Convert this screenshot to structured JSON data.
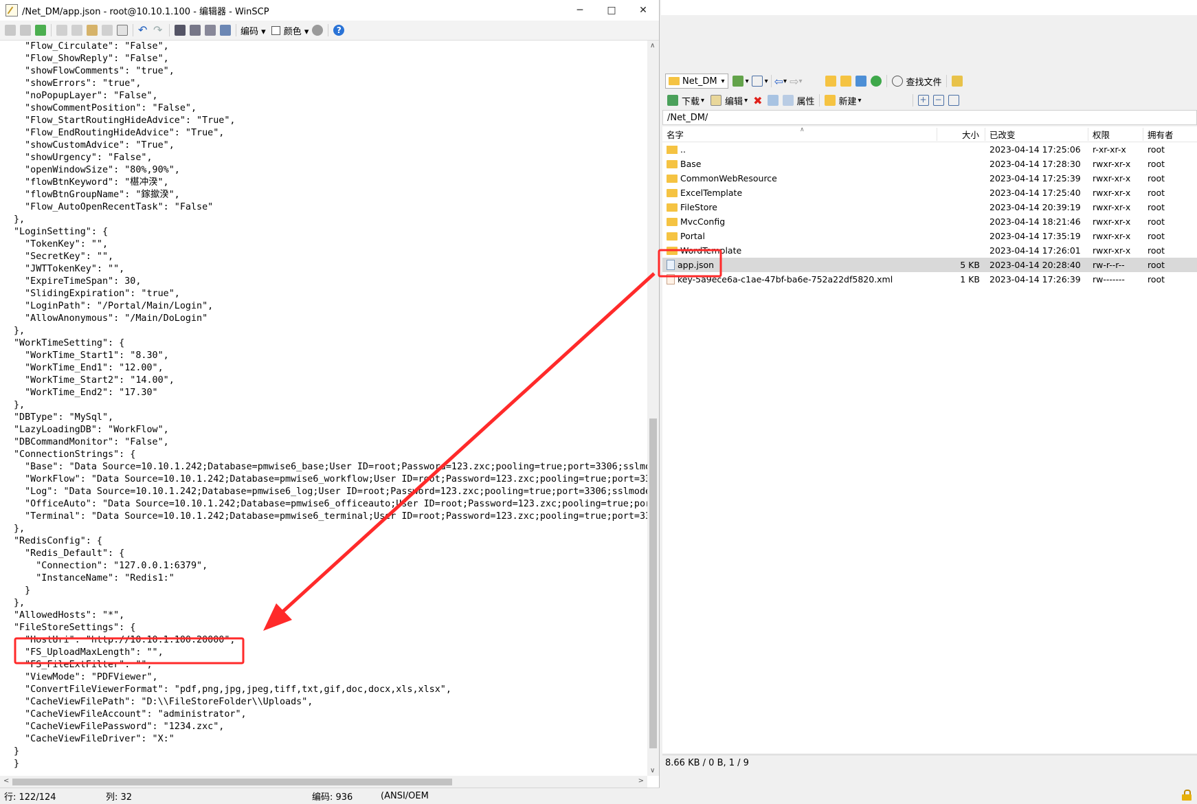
{
  "editor": {
    "title": "/Net_DM/app.json - root@10.10.1.100 - 编辑器 - WinSCP",
    "toolbar": {
      "encoding_label": "编码",
      "color_label": "颜色"
    },
    "code_lines": [
      "  \"Flow_Circulate\": \"False\",",
      "  \"Flow_ShowReply\": \"False\",",
      "  \"showFlowComments\": \"true\",",
      "  \"showErrors\": \"true\",",
      "  \"noPopupLayer\": \"False\",",
      "  \"showCommentPosition\": \"False\",",
      "  \"Flow_StartRoutingHideAdvice\": \"True\",",
      "  \"Flow_EndRoutingHideAdvice\": \"True\",",
      "  \"showCustomAdvice\": \"True\",",
      "  \"showUrgency\": \"False\",",
      "  \"openWindowSize\": \"80%,90%\",",
      "  \"flowBtnKeyword\": \"椹冲湀\",",
      "  \"flowBtnGroupName\": \"鎵撳湀\",",
      "  \"Flow_AutoOpenRecentTask\": \"False\"",
      "},",
      "\"LoginSetting\": {",
      "  \"TokenKey\": \"\",",
      "  \"SecretKey\": \"\",",
      "  \"JWTTokenKey\": \"\",",
      "  \"ExpireTimeSpan\": 30,",
      "  \"SlidingExpiration\": \"true\",",
      "  \"LoginPath\": \"/Portal/Main/Login\",",
      "  \"AllowAnonymous\": \"/Main/DoLogin\"",
      "},",
      "\"WorkTimeSetting\": {",
      "  \"WorkTime_Start1\": \"8.30\",",
      "  \"WorkTime_End1\": \"12.00\",",
      "  \"WorkTime_Start2\": \"14.00\",",
      "  \"WorkTime_End2\": \"17.30\"",
      "},",
      "\"DBType\": \"MySql\",",
      "\"LazyLoadingDB\": \"WorkFlow\",",
      "\"DBCommandMonitor\": \"False\",",
      "\"ConnectionStrings\": {",
      "  \"Base\": \"Data Source=10.10.1.242;Database=pmwise6_base;User ID=root;Password=123.zxc;pooling=true;port=3306;sslmo",
      "  \"WorkFlow\": \"Data Source=10.10.1.242;Database=pmwise6_workflow;User ID=root;Password=123.zxc;pooling=true;port=33",
      "  \"Log\": \"Data Source=10.10.1.242;Database=pmwise6_log;User ID=root;Password=123.zxc;pooling=true;port=3306;sslmode",
      "  \"OfficeAuto\": \"Data Source=10.10.1.242;Database=pmwise6_officeauto;User ID=root;Password=123.zxc;pooling=true;por",
      "  \"Terminal\": \"Data Source=10.10.1.242;Database=pmwise6_terminal;User ID=root;Password=123.zxc;pooling=true;port=33",
      "},",
      "\"RedisConfig\": {",
      "  \"Redis_Default\": {",
      "    \"Connection\": \"127.0.0.1:6379\",",
      "    \"InstanceName\": \"Redis1:\"",
      "  }",
      "},",
      "\"AllowedHosts\": \"*\",",
      "\"FileStoreSettings\": {",
      "  \"HostUri\": \"http://10.10.1.100:20000\",",
      "  \"FS_UploadMaxLength\": \"\",",
      "  \"FS_FileExtFilter\": \"\",",
      "  \"ViewMode\": \"PDFViewer\",",
      "  \"ConvertFileViewerFormat\": \"pdf,png,jpg,jpeg,tiff,txt,gif,doc,docx,xls,xlsx\",",
      "  \"CacheViewFilePath\": \"D:\\\\FileStoreFolder\\\\Uploads\",",
      "  \"CacheViewFileAccount\": \"administrator\",",
      "  \"CacheViewFilePassword\": \"1234.zxc\",",
      "  \"CacheViewFileDriver\": \"X:\"",
      "}",
      "}"
    ],
    "status": {
      "line": "行: 122/124",
      "col": "列: 32",
      "encoding": "编码: 936",
      "charset": "(ANSI/OEM"
    }
  },
  "explorer": {
    "toolbar": {
      "location": "Net_DM",
      "find_files": "查找文件",
      "download": "下载",
      "edit": "编辑",
      "properties": "属性",
      "new": "新建"
    },
    "path": "/Net_DM/",
    "columns": {
      "name": "名字",
      "size": "大小",
      "changed": "已改变",
      "rights": "权限",
      "owner": "拥有者"
    },
    "files": [
      {
        "name": "..",
        "size": "",
        "changed": "2023-04-14 17:25:06",
        "rights": "r-xr-xr-x",
        "owner": "root",
        "kind": "up"
      },
      {
        "name": "Base",
        "size": "",
        "changed": "2023-04-14 17:28:30",
        "rights": "rwxr-xr-x",
        "owner": "root",
        "kind": "folder"
      },
      {
        "name": "CommonWebResource",
        "size": "",
        "changed": "2023-04-14 17:25:39",
        "rights": "rwxr-xr-x",
        "owner": "root",
        "kind": "folder"
      },
      {
        "name": "ExcelTemplate",
        "size": "",
        "changed": "2023-04-14 17:25:40",
        "rights": "rwxr-xr-x",
        "owner": "root",
        "kind": "folder"
      },
      {
        "name": "FileStore",
        "size": "",
        "changed": "2023-04-14 20:39:19",
        "rights": "rwxr-xr-x",
        "owner": "root",
        "kind": "folder"
      },
      {
        "name": "MvcConfig",
        "size": "",
        "changed": "2023-04-14 18:21:46",
        "rights": "rwxr-xr-x",
        "owner": "root",
        "kind": "folder"
      },
      {
        "name": "Portal",
        "size": "",
        "changed": "2023-04-14 17:35:19",
        "rights": "rwxr-xr-x",
        "owner": "root",
        "kind": "folder"
      },
      {
        "name": "WordTemplate",
        "size": "",
        "changed": "2023-04-14 17:26:01",
        "rights": "rwxr-xr-x",
        "owner": "root",
        "kind": "folder"
      },
      {
        "name": "app.json",
        "size": "5 KB",
        "changed": "2023-04-14 20:28:40",
        "rights": "rw-r--r--",
        "owner": "root",
        "kind": "file",
        "selected": true
      },
      {
        "name": "key-5a9ece6a-c1ae-47bf-ba6e-752a22df5820.xml",
        "size": "1 KB",
        "changed": "2023-04-14 17:26:39",
        "rights": "rw-------",
        "owner": "root",
        "kind": "xml"
      }
    ],
    "status": "8.66 KB / 0 B,  1 / 9"
  },
  "annotation": {
    "color": "#ff2a2a"
  }
}
